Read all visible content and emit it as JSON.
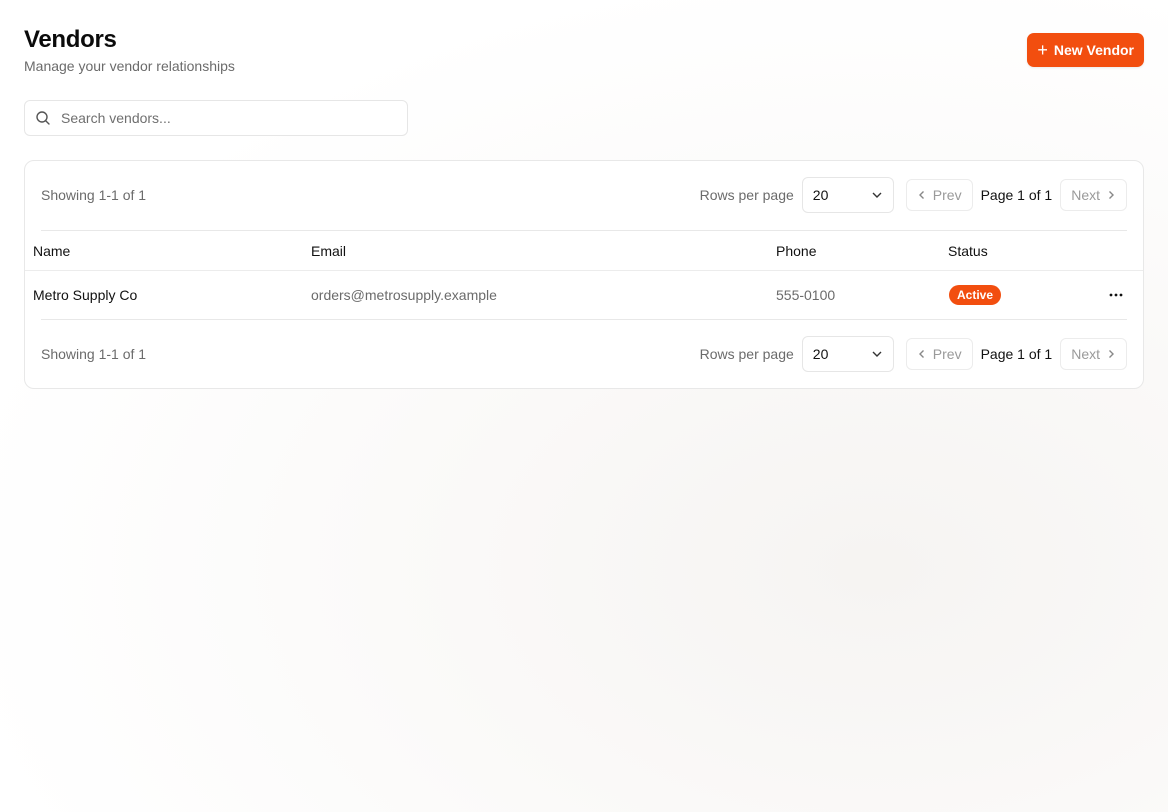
{
  "header": {
    "title": "Vendors",
    "subtitle": "Manage your vendor relationships",
    "new_button_label": "New Vendor"
  },
  "search": {
    "placeholder": "Search vendors...",
    "value": ""
  },
  "pagination": {
    "showing": "Showing 1-1 of 1",
    "rows_per_page_label": "Rows per page",
    "rows_per_page_value": "20",
    "prev_label": "Prev",
    "page_label": "Page 1 of 1",
    "next_label": "Next"
  },
  "table": {
    "columns": [
      "Name",
      "Email",
      "Phone",
      "Status"
    ],
    "rows": [
      {
        "name": "Metro Supply Co",
        "email": "orders@metrosupply.example",
        "phone": "555-0100",
        "status": "Active"
      }
    ]
  },
  "colors": {
    "accent": "#f24e0f",
    "muted_text": "#6b6b6b",
    "border": "#e8e8e8"
  },
  "icons": {
    "search": "search-icon",
    "plus": "plus-icon",
    "chevron_down": "chevron-down-icon",
    "chevron_left": "chevron-left-icon",
    "chevron_right": "chevron-right-icon",
    "more": "more-horizontal-icon"
  }
}
